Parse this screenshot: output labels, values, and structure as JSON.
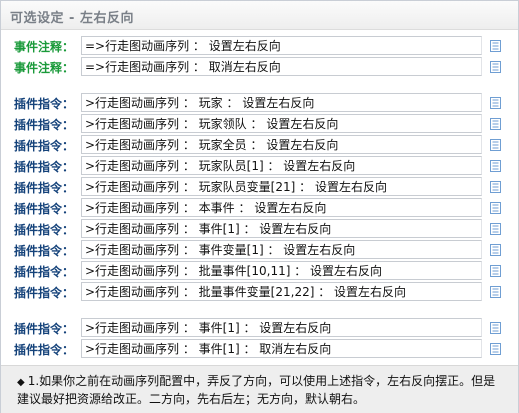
{
  "header": {
    "title": "可选设定 - 左右反向"
  },
  "labels": {
    "comment": "事件注释：",
    "command": "插件指令："
  },
  "comment_rows": [
    {
      "text": "=>行走图动画序列 ： 设置左右反向"
    },
    {
      "text": "=>行走图动画序列 ： 取消左右反向"
    }
  ],
  "command_rows": [
    {
      "text": ">行走图动画序列 ： 玩家 ： 设置左右反向"
    },
    {
      "text": ">行走图动画序列 ： 玩家领队 ： 设置左右反向"
    },
    {
      "text": ">行走图动画序列 ： 玩家全员 ： 设置左右反向"
    },
    {
      "text": ">行走图动画序列 ： 玩家队员[1] ： 设置左右反向"
    },
    {
      "text": ">行走图动画序列 ： 玩家队员变量[21] ： 设置左右反向"
    },
    {
      "text": ">行走图动画序列 ： 本事件 ： 设置左右反向"
    },
    {
      "text": ">行走图动画序列 ： 事件[1] ： 设置左右反向"
    },
    {
      "text": ">行走图动画序列 ： 事件变量[1] ： 设置左右反向"
    },
    {
      "text": ">行走图动画序列 ： 批量事件[10,11] ： 设置左右反向"
    },
    {
      "text": ">行走图动画序列 ： 批量事件变量[21,22] ： 设置左右反向"
    }
  ],
  "command_rows_2": [
    {
      "text": ">行走图动画序列 ： 事件[1] ： 设置左右反向"
    },
    {
      "text": ">行走图动画序列 ： 事件[1] ： 取消左右反向"
    }
  ],
  "note": {
    "bullet": "◆",
    "text": "1.如果你之前在动画序列配置中，弄反了方向，可以使用上述指令，左右反向摆正。但是建议最好把资源给改正。二方向，先右后左；无方向，默认朝右。"
  },
  "icons": {
    "copy": "copy-icon"
  },
  "colors": {
    "comment_label": "#1a9a3a",
    "command_label": "#14427a",
    "icon_blue": "#6f9ed3",
    "title": "#7a8088",
    "note_bg": "#eeeeee"
  }
}
